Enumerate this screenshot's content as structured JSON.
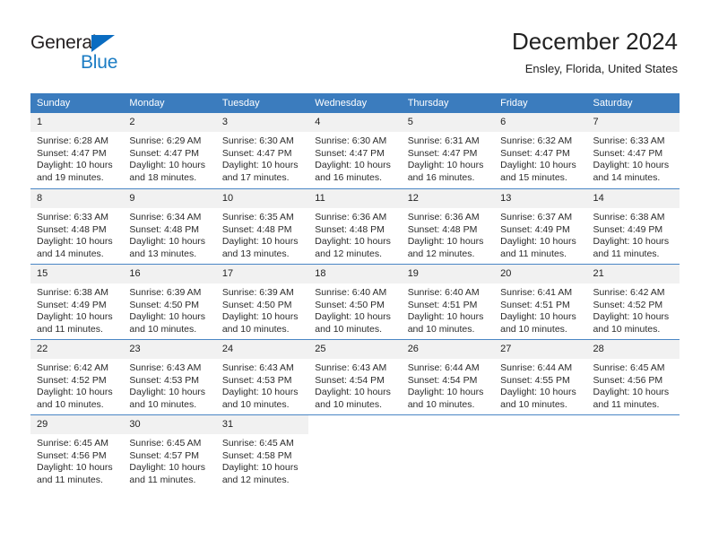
{
  "brand": {
    "name_part1": "General",
    "name_part2": "Blue",
    "icon": "triangle-logo-icon",
    "color_dark": "#231f20",
    "color_blue": "#1b7cc4"
  },
  "header": {
    "title": "December 2024",
    "location": "Ensley, Florida, United States"
  },
  "theme": {
    "header_blue": "#3b7cbe",
    "daynum_band": "#f1f1f1",
    "row_separator": "#4a86c5",
    "text": "#222222"
  },
  "weekday_headers": [
    "Sunday",
    "Monday",
    "Tuesday",
    "Wednesday",
    "Thursday",
    "Friday",
    "Saturday"
  ],
  "weeks": [
    [
      {
        "day": "1",
        "sunrise": "Sunrise: 6:28 AM",
        "sunset": "Sunset: 4:47 PM",
        "daylight_line1": "Daylight: 10 hours",
        "daylight_line2": "and 19 minutes."
      },
      {
        "day": "2",
        "sunrise": "Sunrise: 6:29 AM",
        "sunset": "Sunset: 4:47 PM",
        "daylight_line1": "Daylight: 10 hours",
        "daylight_line2": "and 18 minutes."
      },
      {
        "day": "3",
        "sunrise": "Sunrise: 6:30 AM",
        "sunset": "Sunset: 4:47 PM",
        "daylight_line1": "Daylight: 10 hours",
        "daylight_line2": "and 17 minutes."
      },
      {
        "day": "4",
        "sunrise": "Sunrise: 6:30 AM",
        "sunset": "Sunset: 4:47 PM",
        "daylight_line1": "Daylight: 10 hours",
        "daylight_line2": "and 16 minutes."
      },
      {
        "day": "5",
        "sunrise": "Sunrise: 6:31 AM",
        "sunset": "Sunset: 4:47 PM",
        "daylight_line1": "Daylight: 10 hours",
        "daylight_line2": "and 16 minutes."
      },
      {
        "day": "6",
        "sunrise": "Sunrise: 6:32 AM",
        "sunset": "Sunset: 4:47 PM",
        "daylight_line1": "Daylight: 10 hours",
        "daylight_line2": "and 15 minutes."
      },
      {
        "day": "7",
        "sunrise": "Sunrise: 6:33 AM",
        "sunset": "Sunset: 4:47 PM",
        "daylight_line1": "Daylight: 10 hours",
        "daylight_line2": "and 14 minutes."
      }
    ],
    [
      {
        "day": "8",
        "sunrise": "Sunrise: 6:33 AM",
        "sunset": "Sunset: 4:48 PM",
        "daylight_line1": "Daylight: 10 hours",
        "daylight_line2": "and 14 minutes."
      },
      {
        "day": "9",
        "sunrise": "Sunrise: 6:34 AM",
        "sunset": "Sunset: 4:48 PM",
        "daylight_line1": "Daylight: 10 hours",
        "daylight_line2": "and 13 minutes."
      },
      {
        "day": "10",
        "sunrise": "Sunrise: 6:35 AM",
        "sunset": "Sunset: 4:48 PM",
        "daylight_line1": "Daylight: 10 hours",
        "daylight_line2": "and 13 minutes."
      },
      {
        "day": "11",
        "sunrise": "Sunrise: 6:36 AM",
        "sunset": "Sunset: 4:48 PM",
        "daylight_line1": "Daylight: 10 hours",
        "daylight_line2": "and 12 minutes."
      },
      {
        "day": "12",
        "sunrise": "Sunrise: 6:36 AM",
        "sunset": "Sunset: 4:48 PM",
        "daylight_line1": "Daylight: 10 hours",
        "daylight_line2": "and 12 minutes."
      },
      {
        "day": "13",
        "sunrise": "Sunrise: 6:37 AM",
        "sunset": "Sunset: 4:49 PM",
        "daylight_line1": "Daylight: 10 hours",
        "daylight_line2": "and 11 minutes."
      },
      {
        "day": "14",
        "sunrise": "Sunrise: 6:38 AM",
        "sunset": "Sunset: 4:49 PM",
        "daylight_line1": "Daylight: 10 hours",
        "daylight_line2": "and 11 minutes."
      }
    ],
    [
      {
        "day": "15",
        "sunrise": "Sunrise: 6:38 AM",
        "sunset": "Sunset: 4:49 PM",
        "daylight_line1": "Daylight: 10 hours",
        "daylight_line2": "and 11 minutes."
      },
      {
        "day": "16",
        "sunrise": "Sunrise: 6:39 AM",
        "sunset": "Sunset: 4:50 PM",
        "daylight_line1": "Daylight: 10 hours",
        "daylight_line2": "and 10 minutes."
      },
      {
        "day": "17",
        "sunrise": "Sunrise: 6:39 AM",
        "sunset": "Sunset: 4:50 PM",
        "daylight_line1": "Daylight: 10 hours",
        "daylight_line2": "and 10 minutes."
      },
      {
        "day": "18",
        "sunrise": "Sunrise: 6:40 AM",
        "sunset": "Sunset: 4:50 PM",
        "daylight_line1": "Daylight: 10 hours",
        "daylight_line2": "and 10 minutes."
      },
      {
        "day": "19",
        "sunrise": "Sunrise: 6:40 AM",
        "sunset": "Sunset: 4:51 PM",
        "daylight_line1": "Daylight: 10 hours",
        "daylight_line2": "and 10 minutes."
      },
      {
        "day": "20",
        "sunrise": "Sunrise: 6:41 AM",
        "sunset": "Sunset: 4:51 PM",
        "daylight_line1": "Daylight: 10 hours",
        "daylight_line2": "and 10 minutes."
      },
      {
        "day": "21",
        "sunrise": "Sunrise: 6:42 AM",
        "sunset": "Sunset: 4:52 PM",
        "daylight_line1": "Daylight: 10 hours",
        "daylight_line2": "and 10 minutes."
      }
    ],
    [
      {
        "day": "22",
        "sunrise": "Sunrise: 6:42 AM",
        "sunset": "Sunset: 4:52 PM",
        "daylight_line1": "Daylight: 10 hours",
        "daylight_line2": "and 10 minutes."
      },
      {
        "day": "23",
        "sunrise": "Sunrise: 6:43 AM",
        "sunset": "Sunset: 4:53 PM",
        "daylight_line1": "Daylight: 10 hours",
        "daylight_line2": "and 10 minutes."
      },
      {
        "day": "24",
        "sunrise": "Sunrise: 6:43 AM",
        "sunset": "Sunset: 4:53 PM",
        "daylight_line1": "Daylight: 10 hours",
        "daylight_line2": "and 10 minutes."
      },
      {
        "day": "25",
        "sunrise": "Sunrise: 6:43 AM",
        "sunset": "Sunset: 4:54 PM",
        "daylight_line1": "Daylight: 10 hours",
        "daylight_line2": "and 10 minutes."
      },
      {
        "day": "26",
        "sunrise": "Sunrise: 6:44 AM",
        "sunset": "Sunset: 4:54 PM",
        "daylight_line1": "Daylight: 10 hours",
        "daylight_line2": "and 10 minutes."
      },
      {
        "day": "27",
        "sunrise": "Sunrise: 6:44 AM",
        "sunset": "Sunset: 4:55 PM",
        "daylight_line1": "Daylight: 10 hours",
        "daylight_line2": "and 10 minutes."
      },
      {
        "day": "28",
        "sunrise": "Sunrise: 6:45 AM",
        "sunset": "Sunset: 4:56 PM",
        "daylight_line1": "Daylight: 10 hours",
        "daylight_line2": "and 11 minutes."
      }
    ],
    [
      {
        "day": "29",
        "sunrise": "Sunrise: 6:45 AM",
        "sunset": "Sunset: 4:56 PM",
        "daylight_line1": "Daylight: 10 hours",
        "daylight_line2": "and 11 minutes."
      },
      {
        "day": "30",
        "sunrise": "Sunrise: 6:45 AM",
        "sunset": "Sunset: 4:57 PM",
        "daylight_line1": "Daylight: 10 hours",
        "daylight_line2": "and 11 minutes."
      },
      {
        "day": "31",
        "sunrise": "Sunrise: 6:45 AM",
        "sunset": "Sunset: 4:58 PM",
        "daylight_line1": "Daylight: 10 hours",
        "daylight_line2": "and 12 minutes."
      },
      {
        "day": "",
        "sunrise": "",
        "sunset": "",
        "daylight_line1": "",
        "daylight_line2": ""
      },
      {
        "day": "",
        "sunrise": "",
        "sunset": "",
        "daylight_line1": "",
        "daylight_line2": ""
      },
      {
        "day": "",
        "sunrise": "",
        "sunset": "",
        "daylight_line1": "",
        "daylight_line2": ""
      },
      {
        "day": "",
        "sunrise": "",
        "sunset": "",
        "daylight_line1": "",
        "daylight_line2": ""
      }
    ]
  ]
}
